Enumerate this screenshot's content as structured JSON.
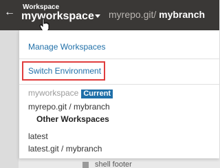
{
  "header": {
    "back_icon": "left-arrow-icon",
    "workspace_label": "Workspace",
    "workspace_name": "myworkspace",
    "repo": "myrepo.git/",
    "branch": "mybranch",
    "colors": {
      "background": "#3a3836",
      "text": "#ffffff",
      "repo_text": "#b9b5b1"
    }
  },
  "menu": {
    "manage_label": "Manage Workspaces",
    "switch_label": "Switch Environment",
    "current": {
      "name": "myworkspace",
      "badge": "Current",
      "repo_branch": "myrepo.git / mybranch"
    },
    "other_heading": "Other Workspaces",
    "others": [
      {
        "name": "latest",
        "repo_branch": "latest.git / mybranch"
      }
    ],
    "colors": {
      "link": "#1f6fa8",
      "highlight_border": "#e03d3d",
      "badge_bg": "#1f6fa8"
    }
  },
  "background": {
    "partial_text": "shell footer"
  }
}
